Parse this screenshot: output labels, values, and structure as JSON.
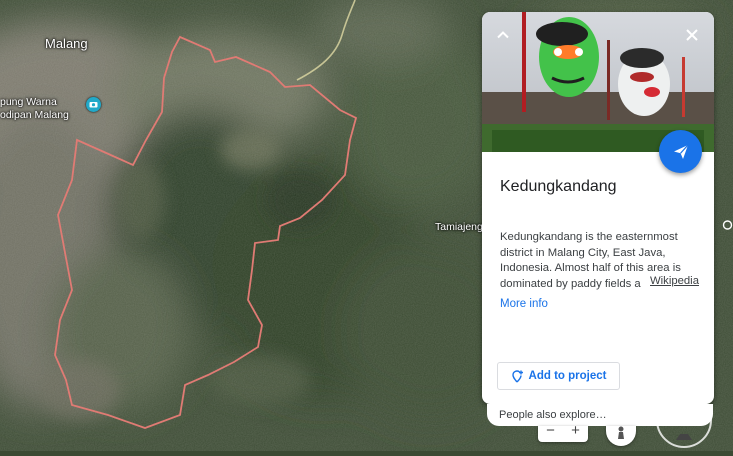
{
  "map": {
    "place_labels": [
      {
        "text": "Malang",
        "type": "city"
      },
      {
        "text": "Tamiajeng",
        "type": "town"
      },
      {
        "text": "pung Warna\nodipan Malang",
        "type": "poi"
      }
    ],
    "boundary_color": "#e07b74"
  },
  "panel": {
    "collapse_icon": "chevron-up-icon",
    "close_icon": "close-icon",
    "share_icon": "share-arrow-icon",
    "title": "Kedungkandang",
    "description": "Kedungkandang is the easternmost district in Malang City, East Java, Indonesia. Almost half of this area is dominated by paddy fields a",
    "source_link": "Wikipedia",
    "more_info": "More info",
    "add_button": "Add to project",
    "accent_color": "#1a73e8"
  },
  "people_also_explore": "People also explore…",
  "controls": {
    "zoom_out": "−",
    "zoom_in": "+"
  }
}
